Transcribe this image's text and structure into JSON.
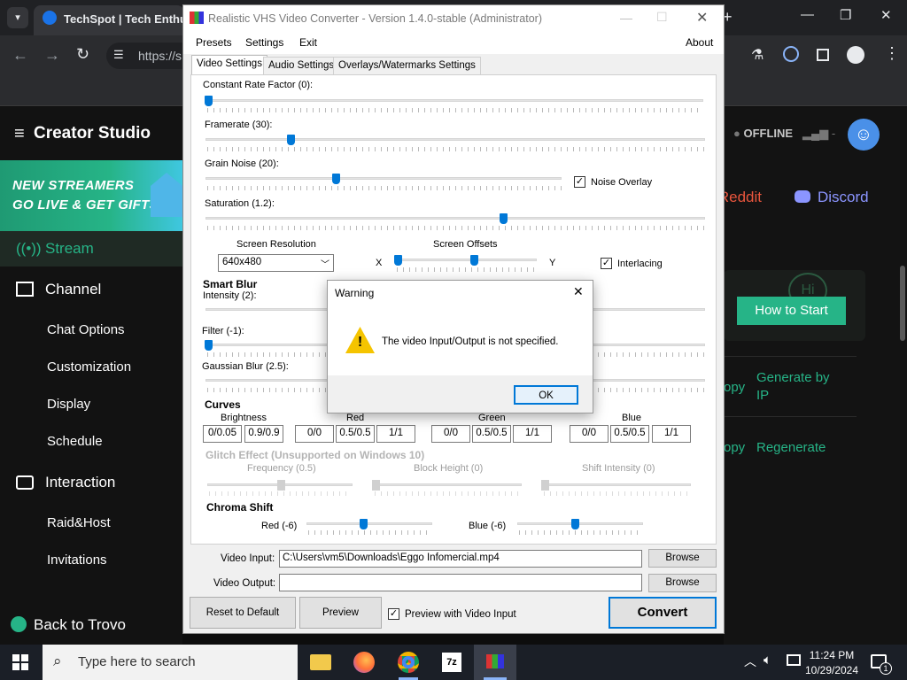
{
  "browser": {
    "tab_title": "TechSpot | Tech Enthu",
    "url": "https://s",
    "controls": {
      "minimize": "—",
      "restore": "❐",
      "close": "✕"
    }
  },
  "trovo": {
    "logo": "Creator Studio",
    "promo": {
      "line1": "NEW STREAMERS",
      "line2": "GO LIVE & GET GIFTS"
    },
    "sidebar": {
      "stream": "Stream",
      "channel": "Channel",
      "channel_items": [
        "Chat Options",
        "Customization",
        "Display",
        "Schedule"
      ],
      "interaction": "Interaction",
      "interaction_items": [
        "Raid&Host",
        "Invitations"
      ],
      "back": "Back to Trovo"
    },
    "status": "OFFLINE",
    "status_signal": "-",
    "links": {
      "reddit": "Reddit",
      "discord": "Discord"
    },
    "how_to_start": "How to Start",
    "generate_by_ip": "Generate by IP",
    "copy1": "opy",
    "copy2": "opy",
    "regenerate": "Regenerate"
  },
  "app": {
    "title": "Realistic VHS Video Converter - Version 1.4.0-stable (Administrator)",
    "menu": {
      "presets": "Presets",
      "settings": "Settings",
      "exit": "Exit",
      "about": "About"
    },
    "tabs": [
      "Video Settings",
      "Audio Settings",
      "Overlays/Watermarks Settings"
    ],
    "sliders": {
      "crf": {
        "label": "Constant Rate Factor (0):",
        "value": 0
      },
      "framerate": {
        "label": "Framerate (30):",
        "value": 30
      },
      "grain": {
        "label": "Grain Noise (20):",
        "value": 20
      },
      "saturation": {
        "label": "Saturation (1.2):",
        "value": 1.2
      },
      "smart_blur_intensity": {
        "label": "Intensity (2):",
        "value": 2
      },
      "filter": {
        "label": "Filter (-1):",
        "value": -1
      },
      "gaussian": {
        "label": "Gaussian Blur (2.5):",
        "value": 2.5
      },
      "chroma_red": {
        "label": "Red (-6)",
        "value": -6
      },
      "chroma_blue": {
        "label": "Blue (-6)",
        "value": -6
      }
    },
    "noise_overlay": {
      "label": "Noise Overlay",
      "checked": true
    },
    "screen_resolution": {
      "label": "Screen Resolution",
      "value": "640x480"
    },
    "screen_offsets": {
      "label": "Screen Offsets",
      "x": "X",
      "y": "Y"
    },
    "interlacing": {
      "label": "Interlacing",
      "checked": true
    },
    "smart_blur": "Smart Blur",
    "curves": {
      "title": "Curves",
      "brightness": {
        "label": "Brightness",
        "values": [
          "0/0.05",
          "0.9/0.9"
        ]
      },
      "red": {
        "label": "Red",
        "values": [
          "0/0",
          "0.5/0.5",
          "1/1"
        ]
      },
      "green": {
        "label": "Green",
        "values": [
          "0/0",
          "0.5/0.5",
          "1/1"
        ]
      },
      "blue": {
        "label": "Blue",
        "values": [
          "0/0",
          "0.5/0.5",
          "1/1"
        ]
      }
    },
    "glitch": {
      "title": "Glitch Effect (Unsupported on Windows 10)",
      "frequency": "Frequency (0.5)",
      "block_height": "Block Height (0)",
      "shift_intensity": "Shift Intensity (0)"
    },
    "chroma_shift": "Chroma Shift",
    "video_input": {
      "label": "Video Input:",
      "value": "C:\\Users\\vm5\\Downloads\\Eggo Infomercial.mp4",
      "browse": "Browse"
    },
    "video_output": {
      "label": "Video Output:",
      "value": "",
      "browse": "Browse"
    },
    "reset": "Reset to Default",
    "preview": "Preview",
    "preview_with_input": {
      "label": "Preview with Video Input",
      "checked": true
    },
    "convert": "Convert"
  },
  "dialog": {
    "title": "Warning",
    "message": "The video Input/Output is not specified.",
    "ok": "OK"
  },
  "taskbar": {
    "search_placeholder": "Type here to search",
    "time": "11:24 PM",
    "date": "10/29/2024",
    "notification_count": "1"
  }
}
